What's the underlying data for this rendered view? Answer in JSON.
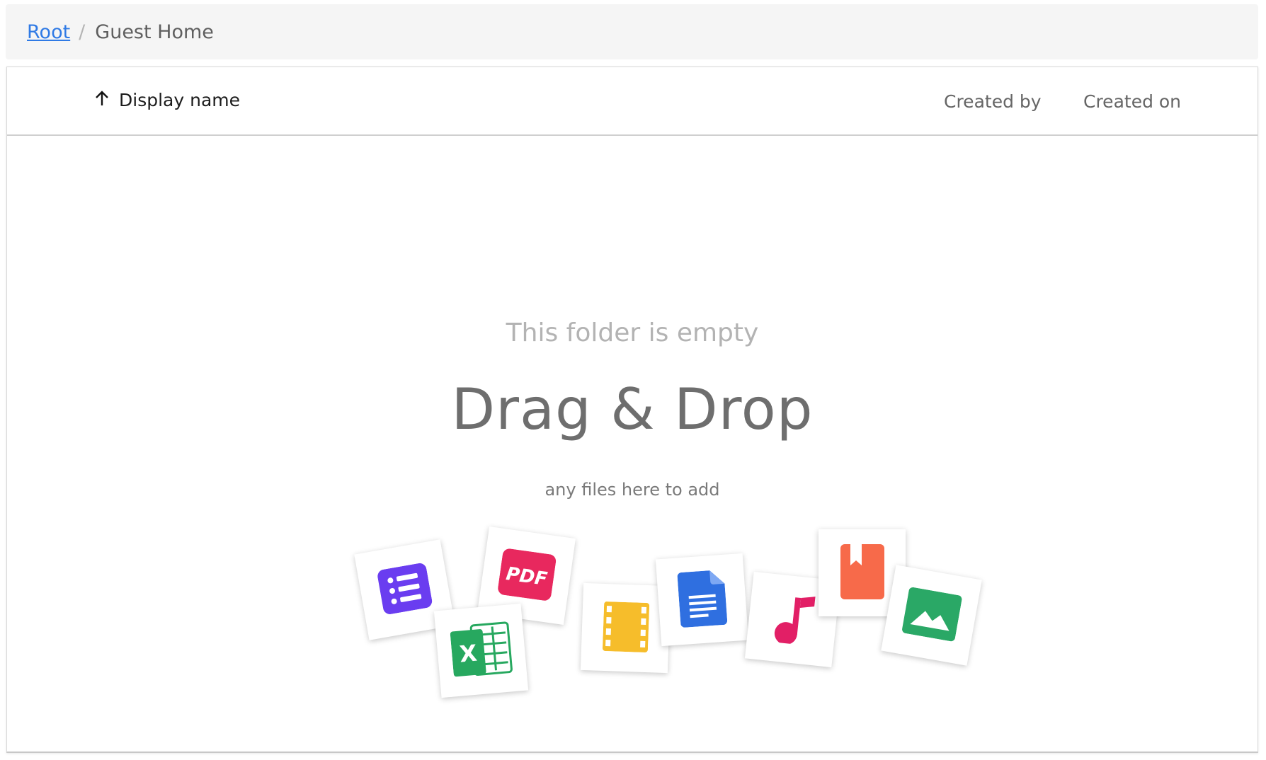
{
  "breadcrumb": {
    "root_label": "Root",
    "separator": "/",
    "current_label": "Guest Home"
  },
  "table": {
    "columns": {
      "display_name": "Display name",
      "created_by": "Created by",
      "created_on": "Created on"
    },
    "sort_icon": "arrow-up-icon"
  },
  "empty_state": {
    "title": "This folder is empty",
    "headline": "Drag & Drop",
    "subtitle": "any files here to add",
    "file_icons": [
      {
        "name": "list-document-icon",
        "color": "#6a3df0"
      },
      {
        "name": "spreadsheet-icon",
        "color": "#27a85f"
      },
      {
        "name": "pdf-icon",
        "color": "#e8285e",
        "text": "PDF"
      },
      {
        "name": "video-film-icon",
        "color": "#f6bd2b"
      },
      {
        "name": "text-document-icon",
        "color": "#2f6fe0"
      },
      {
        "name": "music-note-icon",
        "color": "#e21f66"
      },
      {
        "name": "bookmark-book-icon",
        "color": "#f76a4a"
      },
      {
        "name": "image-icon",
        "color": "#2aa866"
      }
    ]
  },
  "colors": {
    "link": "#2f7ae5",
    "breadcrumb_bg": "#f5f5f5"
  }
}
